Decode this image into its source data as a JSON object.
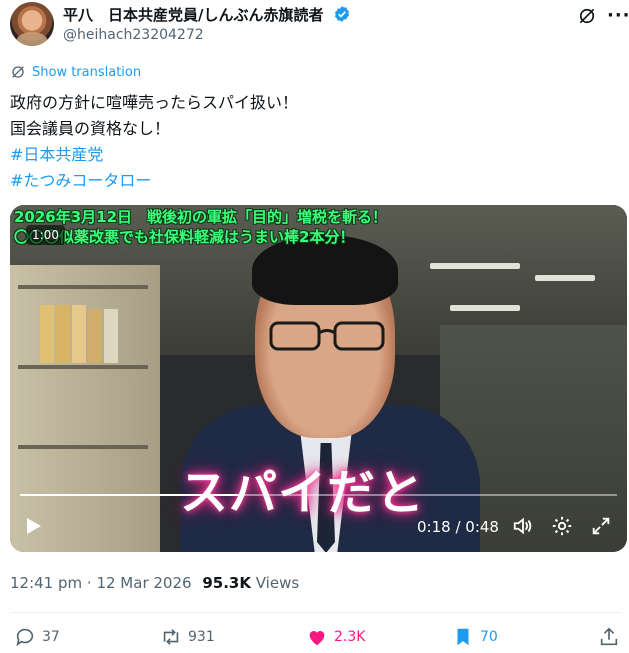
{
  "author": {
    "display_name": "平八　日本共産党員/しんぶん赤旗読者",
    "handle": "@heihach23204272",
    "verified": true
  },
  "translate_label": "Show translation",
  "tweet": {
    "lines": [
      "政府の方針に喧嘩売ったらスパイ扱い！",
      "国会議員の資格なし！"
    ],
    "hashtags": [
      "#日本共産党",
      "#たつみコータロー"
    ]
  },
  "video": {
    "caption_line1": "2026年3月12日　戦後初の軍拡「目的」増税を斬る！",
    "caption_line2": "〇〇〇似薬改悪でも社保料軽減はうまい棒2本分！",
    "chip_time": "1:00",
    "subtitle": "スパイだと",
    "time_readout": "0:18 / 0:48",
    "progress_fraction": 0.375
  },
  "meta": {
    "time": "12:41 pm",
    "separator": " · ",
    "date": "12 Mar 2026",
    "views_count": "95.3K",
    "views_label": " Views"
  },
  "actions": {
    "replies": "37",
    "reposts": "931",
    "likes": "2.3K",
    "bookmarks": "70"
  },
  "colors": {
    "accent": "#1d9bf0",
    "like": "#f91880",
    "text": "#0f1419",
    "secondary": "#536471"
  }
}
